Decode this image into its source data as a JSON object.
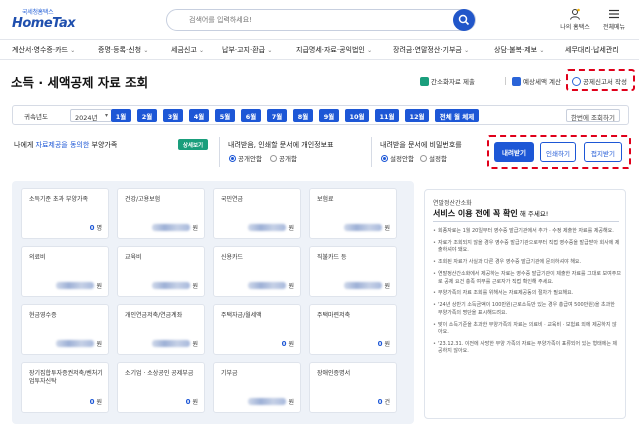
{
  "header": {
    "logo_sub": "국세청홈택스",
    "logo_main": "HomeTax",
    "search_placeholder": "검색어를 입력하세요!",
    "my_hometax": "나의 홈택스",
    "all_menu": "전체메뉴"
  },
  "nav": {
    "items": [
      "계산서·영수증·카드",
      "증명·등록·신청",
      "세금신고",
      "납부·고지·환급",
      "지급명세·자료·공익법인",
      "장려금·연말정산·기부금",
      "상담·불복·제보",
      "세무대리·납세관리"
    ]
  },
  "title": {
    "page_title": "소득 · 세액공제 자료 조회",
    "action_submit": "간소화자료 제출",
    "action_estimate": "예상세액 계산",
    "action_write": "공제신고서 작성"
  },
  "year_bar": {
    "label": "귀속년도",
    "year": "2024년",
    "months": [
      "1월",
      "2월",
      "3월",
      "4월",
      "5월",
      "6월",
      "7월",
      "8월",
      "9월",
      "10월",
      "11월",
      "12월",
      "전체 월 체제"
    ],
    "view_all": "한번에 조회하기"
  },
  "options": {
    "dependents_title_pre": "나에게 ",
    "dependents_title_blue": "자료제공을 동의한",
    "dependents_title_post": " 부양가족",
    "detail_btn": "상세보기",
    "print_title": "내려받음, 인쇄할 문서에 개인정보표",
    "print_opt_on": "공개안함",
    "print_opt_off": "공개함",
    "pw_title": "내려받을 문서에 비밀번호를",
    "pw_opt_on": "설정안함",
    "pw_opt_off": "설정함",
    "btn_download": "내려받기",
    "btn_print": "인쇄하기",
    "btn_collapse": "접지받기"
  },
  "cards": [
    {
      "label": "소득기준 초과 부양가족",
      "value": "0",
      "unit": "명",
      "hidden": false
    },
    {
      "label": "건강/고용보험",
      "value": "",
      "unit": "원",
      "hidden": true
    },
    {
      "label": "국민연금",
      "value": "",
      "unit": "원",
      "hidden": true
    },
    {
      "label": "보험료",
      "value": "",
      "unit": "원",
      "hidden": true
    },
    {
      "label": "의료비",
      "value": "",
      "unit": "원",
      "hidden": true
    },
    {
      "label": "교육비",
      "value": "",
      "unit": "원",
      "hidden": true
    },
    {
      "label": "신용카드",
      "value": "",
      "unit": "원",
      "hidden": true
    },
    {
      "label": "직불카드 등",
      "value": "",
      "unit": "원",
      "hidden": true
    },
    {
      "label": "현금영수증",
      "value": "",
      "unit": "원",
      "hidden": true
    },
    {
      "label": "개인연금저축/연금계좌",
      "value": "",
      "unit": "원",
      "hidden": true
    },
    {
      "label": "주택자금/월세액",
      "value": "0",
      "unit": "원",
      "hidden": false
    },
    {
      "label": "주택마련저축",
      "value": "0",
      "unit": "원",
      "hidden": false
    },
    {
      "label": "장기집합투자증권저축/벤처기업투자신탁",
      "value": "0",
      "unit": "원",
      "hidden": false
    },
    {
      "label": "소기업 · 소상공인 공제부금",
      "value": "0",
      "unit": "원",
      "hidden": false
    },
    {
      "label": "기부금",
      "value": "",
      "unit": "원",
      "hidden": true
    },
    {
      "label": "장애인증명서",
      "value": "0",
      "unit": "건",
      "hidden": false
    }
  ],
  "notice": {
    "sub": "연말정산간소화",
    "title_main": "서비스 이용 전에 꼭 확인",
    "title_tail": " 해 주세요!",
    "items": [
      "회종자료는 1월 20일부터 영수증 발급기관에서 추가 · 수정 제출한 자료를 제공해요.",
      "자료가 조회되지 않을 경우 영수증 발급기관으로부터 직접 영수증을 발급받아 회사에 제출하셔야 돼요.",
      "조회된 자료가 사실과 다른 경우 영수증 발급기관에 문의하셔야 해요.",
      "연말정산간소화에서 제공하는 자료는 영수증 발급기관이 제출한 자료를 그대로 보여주므로 공제 요건 충족 여부를 근로자가 직접 확인해 주세요.",
      "부양가족의 자료 조회를 위해서는 자료제공동의 절차가 필요해요.",
      "'24년 상반기 소득금액이 100만원(근로소득만 있는 경우 총급여 500만원)을 초과한 부양가족의 명단을 표시해드려요.",
      "맞이 소득기준을 초과한 부양가족의 자료는 의료비 · 교육비 · 보험료 외에 제공하지 않아요.",
      "'23.12.31. 이전에 사망한 부양 가족의 자료는 부양가족이 표류되어 있는 형태에는 제공하지 않아요."
    ]
  },
  "colors": {
    "primary": "#1d57d6",
    "highlight": "#e0001a",
    "detail_btn": "#1a9e7c"
  }
}
